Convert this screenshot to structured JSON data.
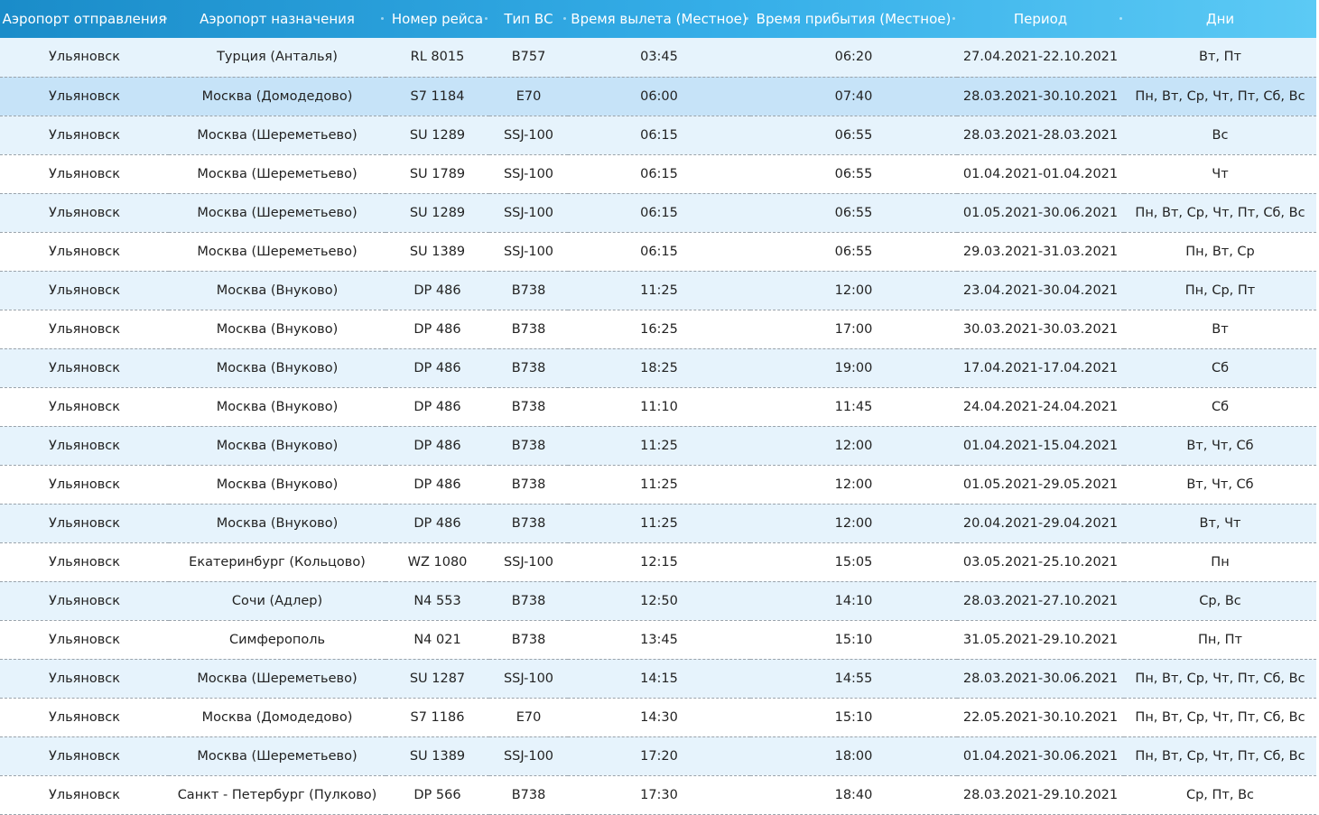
{
  "columns": [
    "Аэропорт отправления",
    "Аэропорт назначения",
    "Номер рейса",
    "Тип ВС",
    "Время вылета (Местное)",
    "Время прибытия (Местное)",
    "Период",
    "Дни"
  ],
  "rows": [
    [
      "Ульяновск",
      "Турция (Анталья)",
      "RL 8015",
      "B757",
      "03:45",
      "06:20",
      "27.04.2021-22.10.2021",
      "Вт, Пт"
    ],
    [
      "Ульяновск",
      "Москва (Домодедово)",
      "S7 1184",
      "E70",
      "06:00",
      "07:40",
      "28.03.2021-30.10.2021",
      "Пн, Вт, Ср, Чт, Пт, Сб, Вс"
    ],
    [
      "Ульяновск",
      "Москва (Шереметьево)",
      "SU 1289",
      "SSJ-100",
      "06:15",
      "06:55",
      "28.03.2021-28.03.2021",
      "Вс"
    ],
    [
      "Ульяновск",
      "Москва (Шереметьево)",
      "SU 1789",
      "SSJ-100",
      "06:15",
      "06:55",
      "01.04.2021-01.04.2021",
      "Чт"
    ],
    [
      "Ульяновск",
      "Москва (Шереметьево)",
      "SU 1289",
      "SSJ-100",
      "06:15",
      "06:55",
      "01.05.2021-30.06.2021",
      "Пн, Вт, Ср, Чт, Пт, Сб, Вс"
    ],
    [
      "Ульяновск",
      "Москва (Шереметьево)",
      "SU 1389",
      "SSJ-100",
      "06:15",
      "06:55",
      "29.03.2021-31.03.2021",
      "Пн, Вт, Ср"
    ],
    [
      "Ульяновск",
      "Москва (Внуково)",
      "DP 486",
      "B738",
      "11:25",
      "12:00",
      "23.04.2021-30.04.2021",
      "Пн, Ср, Пт"
    ],
    [
      "Ульяновск",
      "Москва (Внуково)",
      "DP 486",
      "B738",
      "16:25",
      "17:00",
      "30.03.2021-30.03.2021",
      "Вт"
    ],
    [
      "Ульяновск",
      "Москва (Внуково)",
      "DP 486",
      "B738",
      "18:25",
      "19:00",
      "17.04.2021-17.04.2021",
      "Сб"
    ],
    [
      "Ульяновск",
      "Москва (Внуково)",
      "DP 486",
      "B738",
      "11:10",
      "11:45",
      "24.04.2021-24.04.2021",
      "Сб"
    ],
    [
      "Ульяновск",
      "Москва (Внуково)",
      "DP 486",
      "B738",
      "11:25",
      "12:00",
      "01.04.2021-15.04.2021",
      "Вт, Чт, Сб"
    ],
    [
      "Ульяновск",
      "Москва (Внуково)",
      "DP 486",
      "B738",
      "11:25",
      "12:00",
      "01.05.2021-29.05.2021",
      "Вт, Чт, Сб"
    ],
    [
      "Ульяновск",
      "Москва (Внуково)",
      "DP 486",
      "B738",
      "11:25",
      "12:00",
      "20.04.2021-29.04.2021",
      "Вт, Чт"
    ],
    [
      "Ульяновск",
      "Екатеринбург (Кольцово)",
      "WZ 1080",
      "SSJ-100",
      "12:15",
      "15:05",
      "03.05.2021-25.10.2021",
      "Пн"
    ],
    [
      "Ульяновск",
      "Сочи (Адлер)",
      "N4 553",
      "B738",
      "12:50",
      "14:10",
      "28.03.2021-27.10.2021",
      "Ср, Вс"
    ],
    [
      "Ульяновск",
      "Симферополь",
      "N4 021",
      "B738",
      "13:45",
      "15:10",
      "31.05.2021-29.10.2021",
      "Пн, Пт"
    ],
    [
      "Ульяновск",
      "Москва (Шереметьево)",
      "SU 1287",
      "SSJ-100",
      "14:15",
      "14:55",
      "28.03.2021-30.06.2021",
      "Пн, Вт, Ср, Чт, Пт, Сб, Вс"
    ],
    [
      "Ульяновск",
      "Москва (Домодедово)",
      "S7 1186",
      "E70",
      "14:30",
      "15:10",
      "22.05.2021-30.10.2021",
      "Пн, Вт, Ср, Чт, Пт, Сб, Вс"
    ],
    [
      "Ульяновск",
      "Москва (Шереметьево)",
      "SU 1389",
      "SSJ-100",
      "17:20",
      "18:00",
      "01.04.2021-30.06.2021",
      "Пн, Вт, Ср, Чт, Пт, Сб, Вс"
    ],
    [
      "Ульяновск",
      "Санкт - Петербург (Пулково)",
      "DP 566",
      "B738",
      "17:30",
      "18:40",
      "28.03.2021-29.10.2021",
      "Ср, Пт, Вс"
    ]
  ],
  "highlighted_row": 2
}
